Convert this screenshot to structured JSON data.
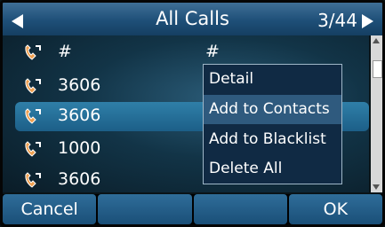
{
  "header": {
    "title": "All Calls",
    "counter": "3/44"
  },
  "calls": [
    {
      "number": "#",
      "secondary": "#"
    },
    {
      "number": "3606",
      "secondary": ""
    },
    {
      "number": "3606",
      "secondary": ""
    },
    {
      "number": "1000",
      "secondary": ""
    },
    {
      "number": "3606",
      "secondary": ""
    }
  ],
  "menu": {
    "items": [
      "Detail",
      "Add to Contacts",
      "Add to Blacklist",
      "Delete All"
    ],
    "highlighted_index": 1
  },
  "softkeys": [
    "Cancel",
    "",
    "",
    "OK"
  ],
  "colors": {
    "title_bar": "#1e4f78",
    "selection": "#2f7fa8",
    "menu_bg": "#102a44",
    "menu_highlight": "#2f5a7e"
  }
}
